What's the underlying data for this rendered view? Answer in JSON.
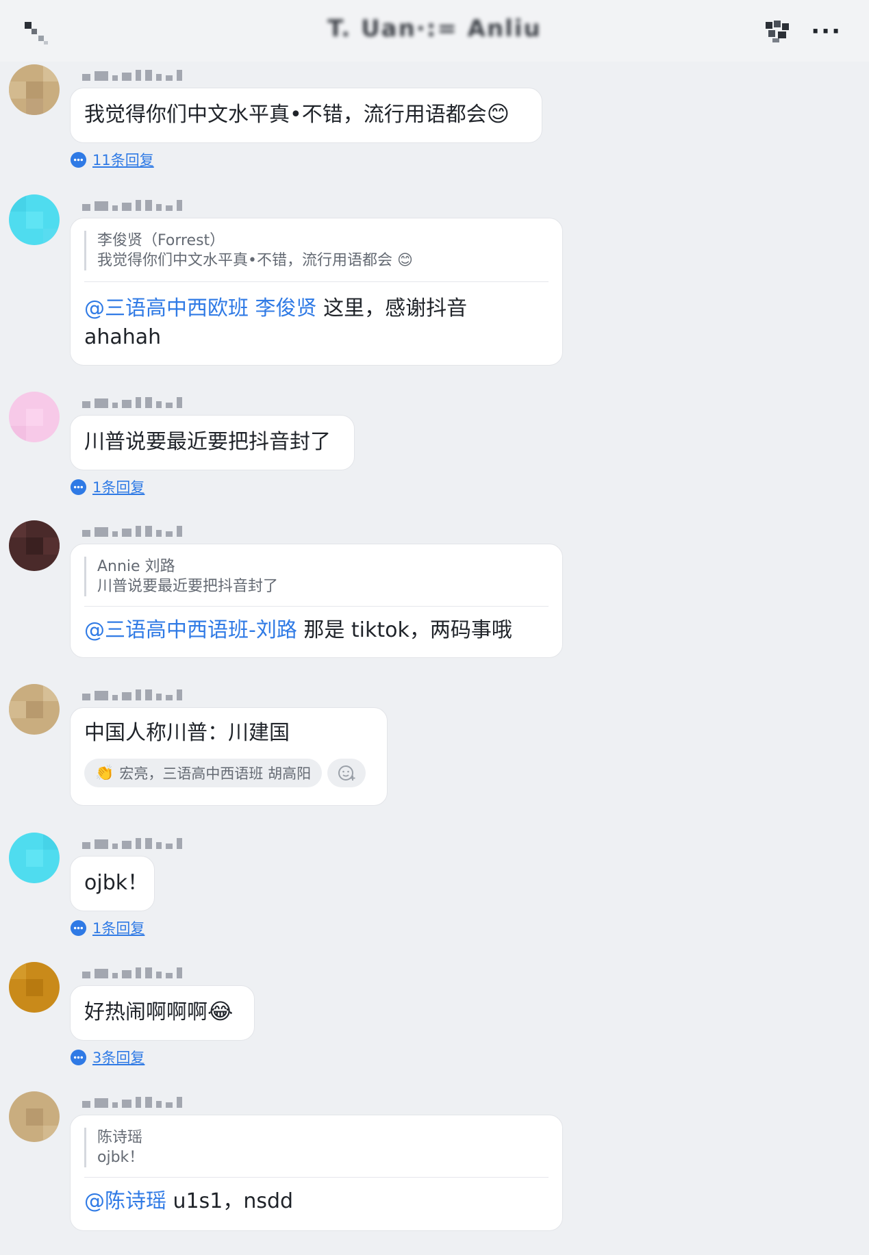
{
  "header": {
    "title_blurred": "T. Uan·:= Anliu",
    "more_label": "···"
  },
  "messages": [
    {
      "text": "我觉得你们中文水平真•不错，流行用语都会",
      "emoji": "😊",
      "reply_count": "11条回复"
    },
    {
      "quote_author": "李俊贤（Forrest）",
      "quote_text": "我觉得你们中文水平真•不错，流行用语都会",
      "quote_emoji": "😊",
      "mention": "@三语高中西欧班 李俊贤",
      "text": " 这里，感谢抖音 ahahah"
    },
    {
      "text": "川普说要最近要把抖音封了",
      "reply_count": "1条回复"
    },
    {
      "quote_author": "Annie 刘路",
      "quote_text": "川普说要最近要把抖音封了",
      "mention": "@三语高中西语班-刘路",
      "text": " 那是 tiktok，两码事哦"
    },
    {
      "text": "中国人称川普：川建国",
      "reaction_emoji": "👏",
      "reaction_users": "宏亮，三语高中西语班 胡高阳"
    },
    {
      "text": "ojbk！",
      "reply_count": "1条回复"
    },
    {
      "text": "好热闹啊啊啊",
      "emoji": "😂",
      "reply_count": "3条回复"
    },
    {
      "quote_author": "陈诗瑶",
      "quote_text": "ojbk！",
      "mention": "@陈诗瑶",
      "text": " u1s1，nsdd"
    }
  ],
  "colors": {
    "background": "#eef0f3",
    "mention": "#2f7ae5",
    "avatar_tan": "#c9ad7f",
    "avatar_cyan": "#4fdcef",
    "avatar_pink": "#f7c9e8",
    "avatar_dark": "#4a2a2a",
    "avatar_amber": "#c98a1a"
  }
}
